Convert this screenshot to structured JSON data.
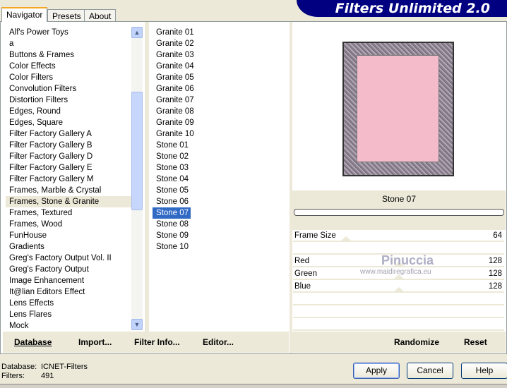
{
  "banner": "Filters Unlimited 2.0",
  "tabs": [
    "Navigator",
    "Presets",
    "About"
  ],
  "categories": [
    "Alf's Power Toys",
    "a",
    "Buttons & Frames",
    "Color Effects",
    "Color Filters",
    "Convolution Filters",
    "Distortion Filters",
    "Edges, Round",
    "Edges, Square",
    "Filter Factory Gallery A",
    "Filter Factory Gallery B",
    "Filter Factory Gallery D",
    "Filter Factory Gallery E",
    "Filter Factory Gallery M",
    "Frames, Marble & Crystal",
    "Frames, Stone & Granite",
    "Frames, Textured",
    "Frames, Wood",
    "FunHouse",
    "Gradients",
    "Greg's Factory Output Vol. II",
    "Greg's Factory Output",
    "Image Enhancement",
    "It@lian Editors Effect",
    "Lens Effects",
    "Lens Flares",
    "Mock"
  ],
  "filters": [
    "Granite 01",
    "Granite 02",
    "Granite 03",
    "Granite 04",
    "Granite 05",
    "Granite 06",
    "Granite 07",
    "Granite 08",
    "Granite 09",
    "Granite 10",
    "Stone 01",
    "Stone 02",
    "Stone 03",
    "Stone 04",
    "Stone 05",
    "Stone 06",
    "Stone 07",
    "Stone 08",
    "Stone 09",
    "Stone 10"
  ],
  "selected_filter": "Stone 07",
  "progress": 0,
  "sliders": [
    {
      "label": "Frame Size",
      "value": "64"
    },
    {
      "label": "Red",
      "value": "128"
    },
    {
      "label": "Green",
      "value": "128"
    },
    {
      "label": "Blue",
      "value": "128"
    }
  ],
  "watermark": {
    "name": "Pinuccia",
    "url": "www.maidiregrafica.eu"
  },
  "bottom_left": [
    "Database",
    "Import...",
    "Filter Info...",
    "Editor..."
  ],
  "bottom_right": [
    "Randomize",
    "Reset"
  ],
  "status": {
    "db_label": "Database:",
    "db_value": "ICNET-Filters",
    "filters_label": "Filters:",
    "filters_value": "491"
  },
  "buttons": {
    "apply": "Apply",
    "cancel": "Cancel",
    "help": "Help"
  }
}
